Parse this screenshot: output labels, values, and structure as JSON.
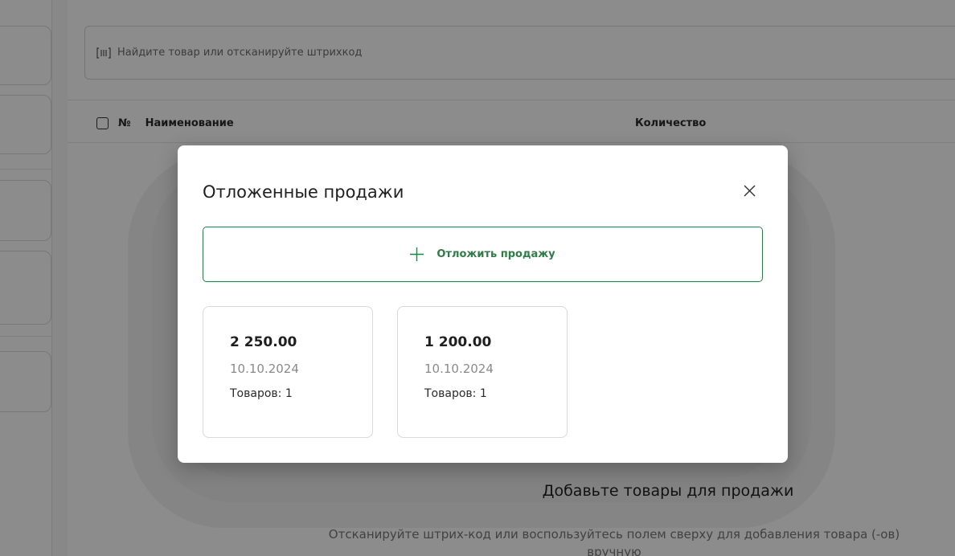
{
  "search": {
    "placeholder": "Найдите товар или отсканируйте штрихкод"
  },
  "table": {
    "headers": {
      "number": "№",
      "name": "Наименование",
      "quantity": "Количество"
    }
  },
  "empty_state": {
    "title": "Добавьте товары для продажи",
    "subtitle": "Отсканируйте штрих-код или воспользуйтесь полем сверху для добавления товара (-ов) вручную"
  },
  "modal": {
    "title": "Отложенные продажи",
    "postpone_button": "Отложить продажу",
    "sales": [
      {
        "amount": "2 250.00",
        "date": "10.10.2024",
        "items": "Товаров: 1"
      },
      {
        "amount": "1 200.00",
        "date": "10.10.2024",
        "items": "Товаров: 1"
      }
    ]
  },
  "colors": {
    "accent": "#2e7d46",
    "overlay": "rgba(0,0,0,0.45)"
  }
}
